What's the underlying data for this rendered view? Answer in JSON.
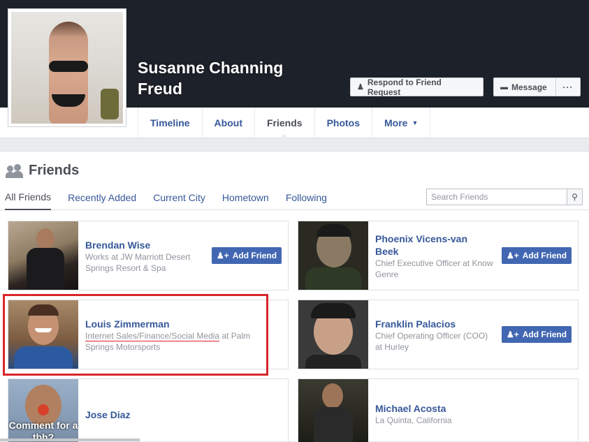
{
  "profile": {
    "name": "Susanne Channing Freud",
    "respond_label": "Respond to Friend Request",
    "message_label": "Message",
    "more_dots": "···"
  },
  "nav": {
    "tabs": [
      {
        "label": "Timeline"
      },
      {
        "label": "About"
      },
      {
        "label": "Friends"
      },
      {
        "label": "Photos"
      },
      {
        "label": "More"
      }
    ],
    "active": "Friends"
  },
  "friends_section": {
    "title": "Friends",
    "subtabs": [
      "All Friends",
      "Recently Added",
      "Current City",
      "Hometown",
      "Following"
    ],
    "active_subtab": "All Friends",
    "search_placeholder": "Search Friends"
  },
  "add_friend_label": "Add Friend",
  "friends": [
    {
      "name": "Brendan Wise",
      "line1": "Works at JW Marriott Desert",
      "line2": "Springs Resort & Spa",
      "add_friend": true
    },
    {
      "name": "Phoenix Vicens-van",
      "name2": "Beek",
      "line1": "Chief Executive Officer at Know",
      "line2": "Genre",
      "add_friend": true
    },
    {
      "name": "Louis Zimmerman",
      "line1_link": "Internet Sales/Finance/Social Media",
      "line1_rest": " at Palm",
      "line2": "Springs Motorsports",
      "add_friend": false
    },
    {
      "name": "Franklin Palacios",
      "line1": "Chief Operating Officer (COO)",
      "line2": "at Hurley",
      "add_friend": true
    },
    {
      "name": "Jose Diaz",
      "photo_caption": "Comment for a tbh?",
      "add_friend": false
    },
    {
      "name": "Michael Acosta",
      "line1": "La Quinta, California",
      "add_friend": false
    }
  ],
  "colors": {
    "cover": "#1d2129",
    "link": "#365899",
    "button_blue": "#4267b2",
    "highlight": "#d9262b"
  }
}
